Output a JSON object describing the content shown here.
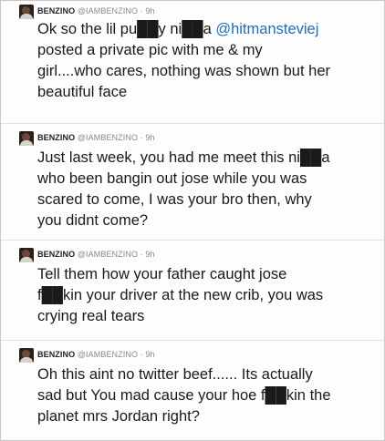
{
  "tweets": [
    {
      "name": "BENZINO",
      "handle": "@IAMBENZINO",
      "separator": "·",
      "time": "9h",
      "text_before_mention": "Ok so the lil pu██y ni██a ",
      "mention": "@hitmansteviej",
      "text_after_mention": "\nposted a private pic with me & my\ngirl....who cares, nothing was shown but her\nbeautiful face"
    },
    {
      "name": "BENZINO",
      "handle": "@IAMBENZINO",
      "separator": "·",
      "time": "9h",
      "text": "Just last week, you had me meet this ni██a\nwho been bangin out jose while you was\nscared to come, I was your bro then, why\nyou didnt come?"
    },
    {
      "name": "BENZINO",
      "handle": "@IAMBENZINO",
      "separator": "·",
      "time": "9h",
      "text": "Tell them how your father caught jose\nf██kin your driver at the new crib, you was\ncrying real tears"
    },
    {
      "name": "BENZINO",
      "handle": "@IAMBENZINO",
      "separator": "·",
      "time": "9h",
      "text": "Oh this aint no twitter beef...... Its actually\nsad but You mad cause your hoe f██kin the\nplanet mrs Jordan right?"
    }
  ],
  "colors": {
    "mention": "#1d6fb8",
    "meta": "#8a8a8a",
    "text": "#1a1a1a"
  },
  "icons": {
    "avatar": "profile-avatar"
  }
}
